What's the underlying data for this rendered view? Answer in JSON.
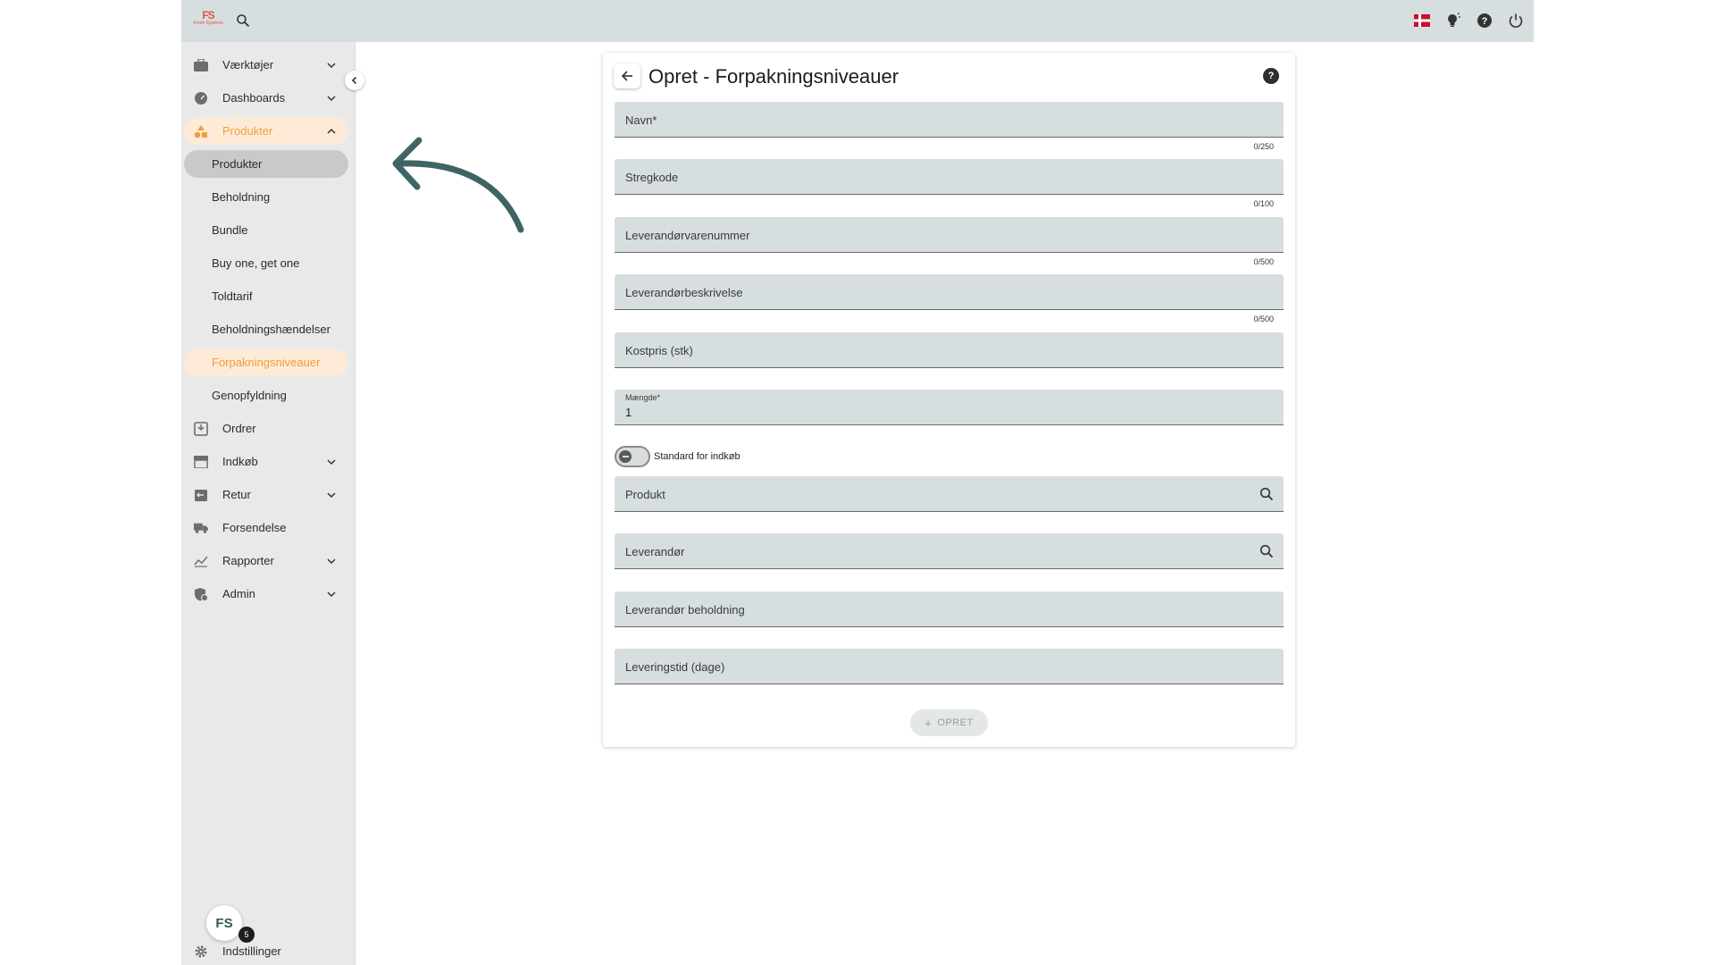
{
  "topbar": {
    "logo_mark": "FS",
    "logo_sub": "Fresh Systems",
    "icons": [
      "search-icon",
      "danish-flag-icon",
      "lightbulb-icon",
      "help-icon",
      "power-icon"
    ]
  },
  "sidebar": {
    "items": [
      {
        "label": "Værktøjer",
        "icon": "toolbox-icon"
      },
      {
        "label": "Dashboards",
        "icon": "speedometer-icon"
      },
      {
        "label": "Produkter",
        "icon": "shapes-icon"
      },
      {
        "label": "Ordrer",
        "icon": "inbox-icon"
      },
      {
        "label": "Indkøb",
        "icon": "store-icon"
      },
      {
        "label": "Retur",
        "icon": "return-box-icon"
      },
      {
        "label": "Forsendelse",
        "icon": "truck-icon"
      },
      {
        "label": "Rapporter",
        "icon": "chart-icon"
      },
      {
        "label": "Admin",
        "icon": "admin-shield-icon"
      }
    ],
    "sub_items": [
      {
        "label": "Produkter"
      },
      {
        "label": "Beholdning"
      },
      {
        "label": "Bundle"
      },
      {
        "label": "Buy one, get one"
      },
      {
        "label": "Toldtarif"
      },
      {
        "label": "Beholdningshændelser"
      },
      {
        "label": "Forpakningsniveauer"
      },
      {
        "label": "Genopfyldning"
      }
    ],
    "settings_label": "Indstillinger",
    "badge_text": "FS",
    "badge_count": "5"
  },
  "form": {
    "title": "Opret - Forpakningsniveauer",
    "fields": {
      "navn": {
        "label": "Navn*",
        "counter": "0/250"
      },
      "stregkode": {
        "label": "Stregkode",
        "counter": "0/100"
      },
      "leverandorvarenummer": {
        "label": "Leverandørvarenummer",
        "counter": "0/500"
      },
      "leverandorbeskrivelse": {
        "label": "Leverandørbeskrivelse",
        "counter": "0/500"
      },
      "kostpris": {
        "label": "Kostpris (stk)"
      },
      "maengde": {
        "label": "Mængde*",
        "value": "1"
      },
      "produkt": {
        "label": "Produkt"
      },
      "leverandor": {
        "label": "Leverandør"
      },
      "leverandor_beholdning": {
        "label": "Leverandør beholdning"
      },
      "leveringstid": {
        "label": "Leveringstid (dage)"
      }
    },
    "toggle_label": "Standard for indkøb",
    "create_label": "OPRET"
  },
  "colors": {
    "accent_orange": "#f39c3c",
    "field_bg": "#d7dedf",
    "arrow": "#3f6464"
  }
}
